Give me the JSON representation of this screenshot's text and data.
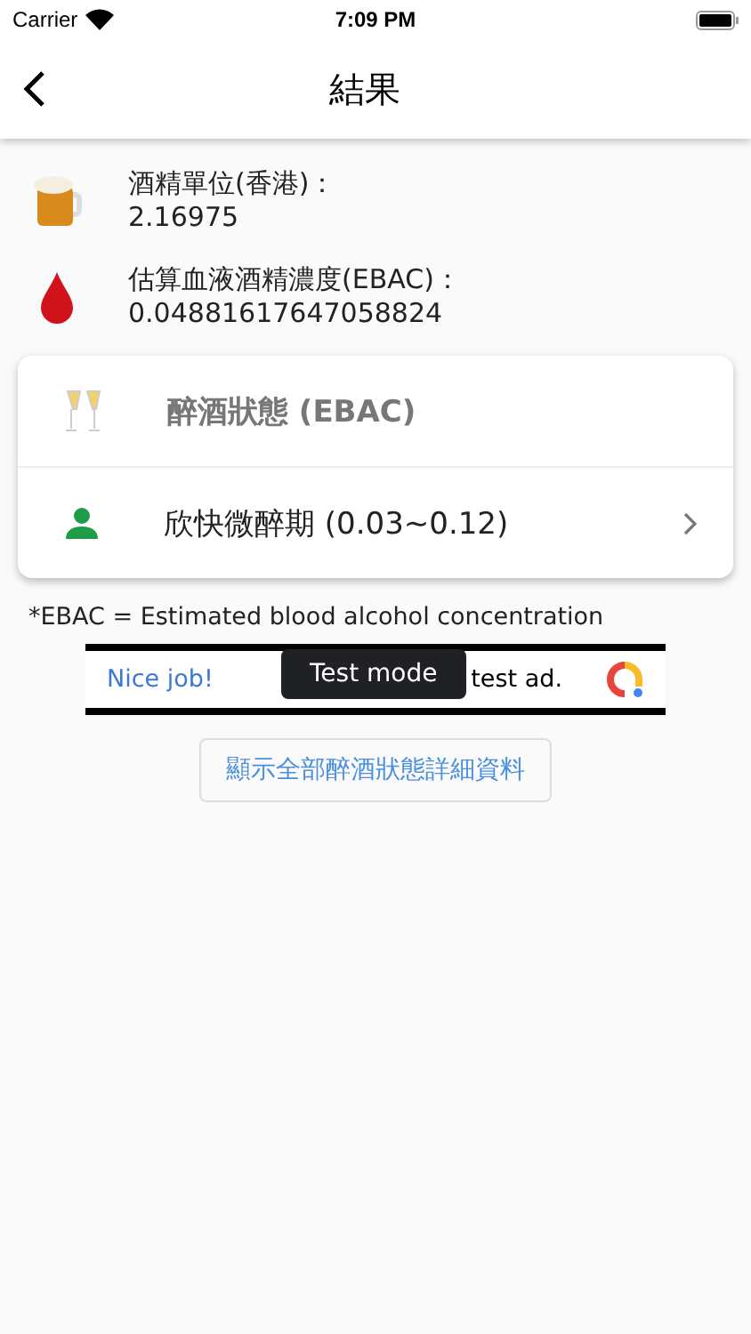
{
  "status_bar": {
    "carrier": "Carrier",
    "time": "7:09 PM"
  },
  "nav": {
    "title": "結果"
  },
  "info": [
    {
      "kind": "beer",
      "label": "酒精單位(香港)：",
      "value": "2.16975"
    },
    {
      "kind": "drop",
      "label": "估算血液酒精濃度(EBAC)：",
      "value": "0.04881617647058824"
    }
  ],
  "card": {
    "header": "醉酒狀態 (EBAC)",
    "status": "欣快微醉期 (0.03~0.12)"
  },
  "footnote": "*EBAC = Estimated blood alcohol concentration",
  "ad": {
    "headline": "Nice job!",
    "text": "test ad.",
    "badge": "Test mode"
  },
  "details_button": "顯示全部醉酒狀態詳細資料"
}
